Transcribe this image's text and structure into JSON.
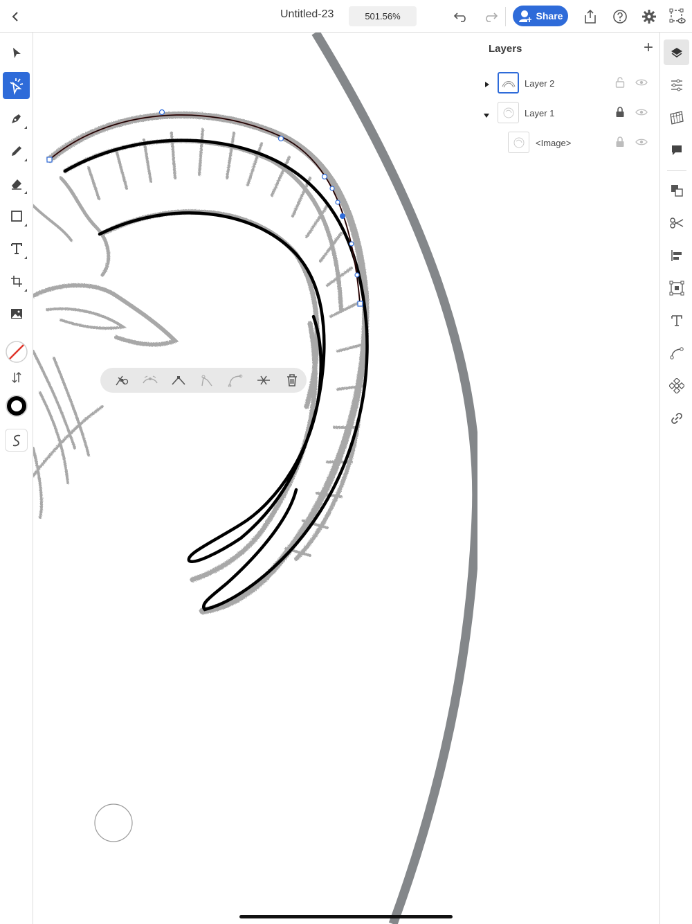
{
  "topbar": {
    "document_title": "Untitled-23",
    "zoom_level": "501.56%",
    "share_label": "Share",
    "icons": [
      "back-chevron-icon",
      "undo-icon",
      "redo-icon",
      "share-person-icon",
      "export-icon",
      "help-icon",
      "settings-icon",
      "fit-screen-icon"
    ]
  },
  "left_toolbar": {
    "tools": [
      "selection-tool",
      "direct-selection-tool",
      "pen-tool",
      "pencil-tool",
      "eraser-tool",
      "rectangle-tool",
      "type-tool",
      "artboard-tool",
      "image-tool",
      "fill-swatch",
      "swap-icon",
      "stroke-swatch",
      "smooth-tool"
    ],
    "active_tool": "direct-selection-tool",
    "fill_color": "none",
    "stroke_color": "#000000"
  },
  "context_toolbar": {
    "actions": [
      "convert-anchor",
      "smooth-points",
      "corner-points",
      "join-points",
      "split-path",
      "cut-path",
      "delete"
    ]
  },
  "layers_panel": {
    "title": "Layers",
    "add_label": "+",
    "layers": [
      {
        "name": "Layer 2",
        "expanded": false,
        "locked": false,
        "visible": true,
        "selected": true
      },
      {
        "name": "Layer 1",
        "expanded": true,
        "locked": true,
        "visible": true,
        "selected": false
      },
      {
        "name": "<Image>",
        "expanded": false,
        "locked": true,
        "visible": true,
        "selected": false
      }
    ]
  },
  "right_rail": {
    "items": [
      "layers-icon",
      "properties-icon",
      "libraries-icon",
      "comments-icon",
      "arrange-icon",
      "pathfinder-icon",
      "align-icon",
      "transform-icon",
      "text-icon",
      "path-icon",
      "repeat-icon",
      "link-icon"
    ],
    "active": "layers-icon"
  },
  "colors": {
    "accent": "#2e6bd9",
    "selection_path": "#6b1f1f"
  }
}
